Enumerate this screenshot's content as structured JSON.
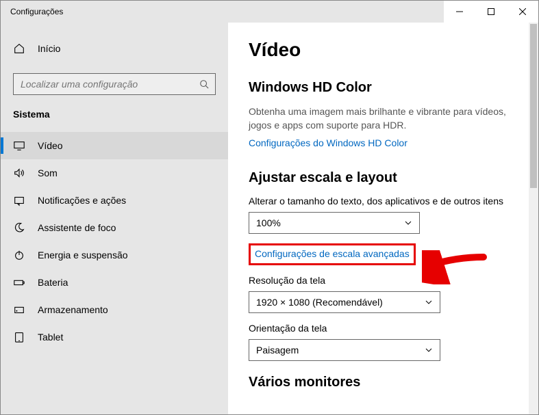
{
  "window": {
    "title": "Configurações"
  },
  "sidebar": {
    "home": "Início",
    "search_placeholder": "Localizar uma configuração",
    "section": "Sistema",
    "items": [
      {
        "label": "Vídeo",
        "icon": "monitor"
      },
      {
        "label": "Som",
        "icon": "sound"
      },
      {
        "label": "Notificações e ações",
        "icon": "notification"
      },
      {
        "label": "Assistente de foco",
        "icon": "moon"
      },
      {
        "label": "Energia e suspensão",
        "icon": "power"
      },
      {
        "label": "Bateria",
        "icon": "battery"
      },
      {
        "label": "Armazenamento",
        "icon": "storage"
      },
      {
        "label": "Tablet",
        "icon": "tablet"
      }
    ]
  },
  "content": {
    "title": "Vídeo",
    "hd": {
      "head": "Windows HD Color",
      "desc": "Obtenha uma imagem mais brilhante e vibrante para vídeos, jogos e apps com suporte para HDR.",
      "link": "Configurações do Windows HD Color"
    },
    "scale": {
      "head": "Ajustar escala e layout",
      "size_label": "Alterar o tamanho do texto, dos aplicativos e de outros itens",
      "size_value": "100%",
      "adv_link": "Configurações de escala avançadas",
      "res_label": "Resolução da tela",
      "res_value": "1920 × 1080 (Recomendável)",
      "orient_label": "Orientação da tela",
      "orient_value": "Paisagem"
    },
    "monitors": {
      "head": "Vários monitores"
    }
  }
}
